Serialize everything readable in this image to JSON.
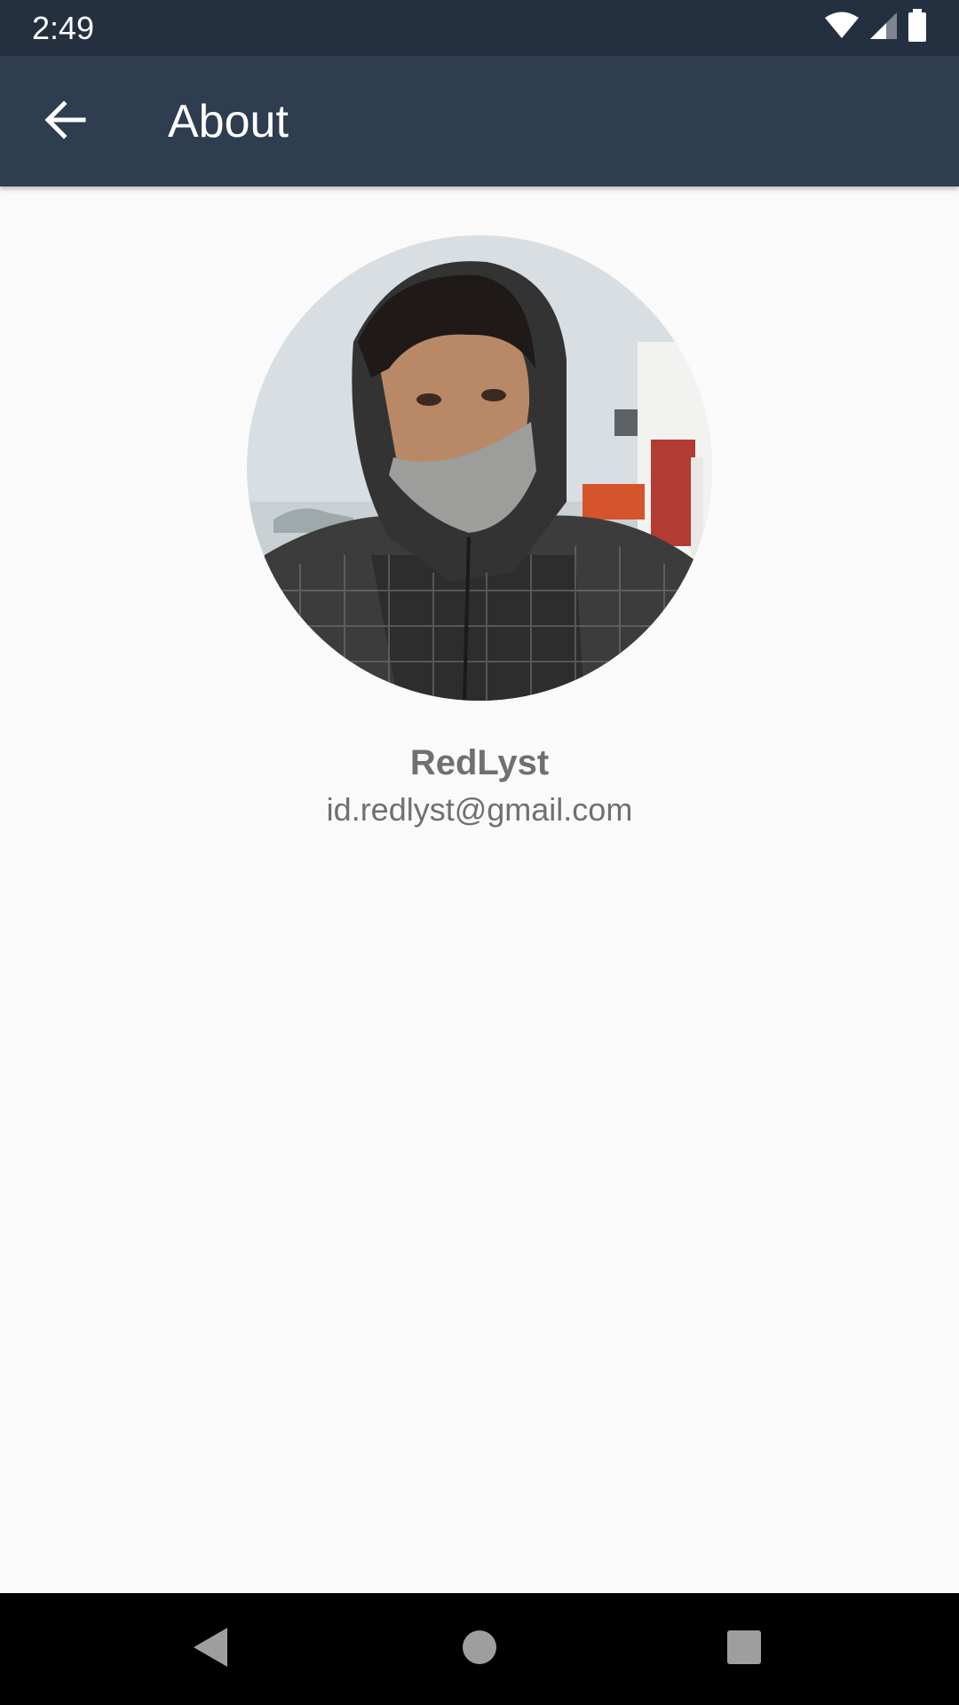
{
  "status_bar": {
    "time": "2:49",
    "icons": [
      "wifi-icon",
      "cellular-signal-icon",
      "battery-icon"
    ]
  },
  "app_bar": {
    "title": "About",
    "back_icon": "arrow-back-icon",
    "background": "#2e3d50"
  },
  "profile": {
    "name": "RedLyst",
    "email": "id.redlyst@gmail.com"
  },
  "nav_bar": {
    "icons": [
      "nav-back-icon",
      "nav-home-icon",
      "nav-recents-icon"
    ]
  },
  "colors": {
    "status_bar": "#243040",
    "app_bar": "#2e3d50",
    "background": "#fafafa",
    "text_secondary": "#707070",
    "nav_bar": "#000000"
  }
}
